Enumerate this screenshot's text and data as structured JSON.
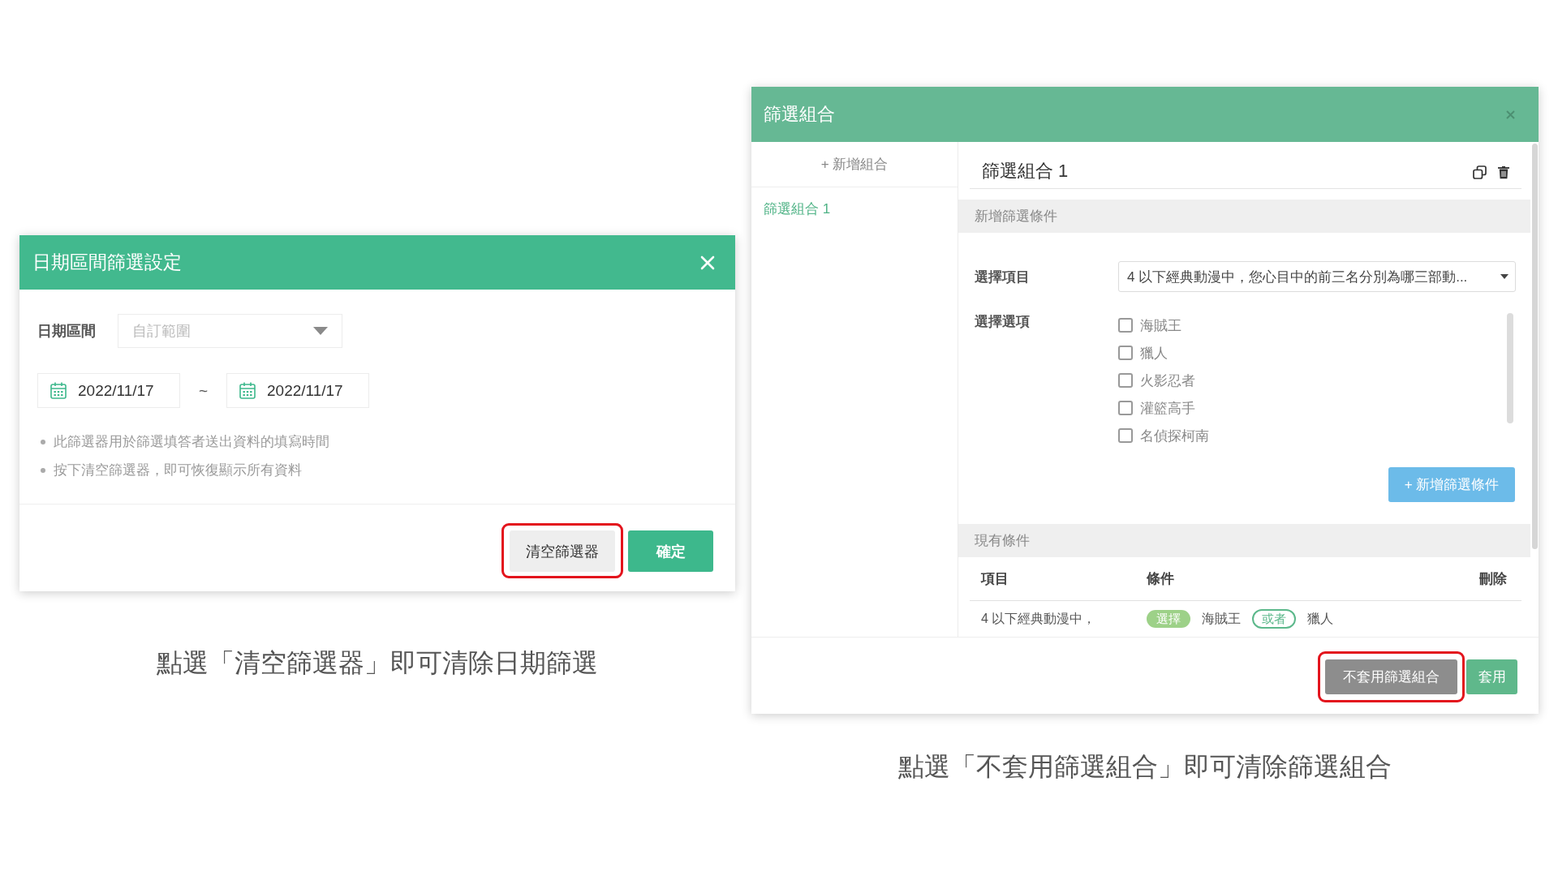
{
  "left_dialog": {
    "title": "日期區間篩選設定",
    "range_label": "日期區間",
    "range_select": {
      "value": "自訂範圍",
      "disabled": true
    },
    "start_date": {
      "value": "2022/11/17"
    },
    "separator": "~",
    "end_date": {
      "value": "2022/11/17"
    },
    "notes": [
      "此篩選器用於篩選填答者送出資料的填寫時間",
      "按下清空篩選器，即可恢復顯示所有資料"
    ],
    "buttons": [
      {
        "label": "清空篩選器",
        "kind": "secondary",
        "highlighted": true
      },
      {
        "label": "確定",
        "kind": "primary",
        "highlighted": false
      }
    ]
  },
  "left_caption": "點選「清空篩選器」即可清除日期篩選",
  "right_dialog": {
    "title": "篩選組合",
    "sidebar": {
      "add_button": "+ 新增組合",
      "items": [
        {
          "label": "篩選組合 1",
          "selected": true
        }
      ]
    },
    "combo_name": "篩選組合 1",
    "add_section": {
      "heading": "新增篩選條件",
      "item_label": "選擇項目",
      "item_select": {
        "value": "4 以下經典動漫中，您心目中的前三名分別為哪三部動..."
      },
      "option_label": "選擇選項",
      "options": [
        {
          "label": "海賊王",
          "checked": false
        },
        {
          "label": "獵人",
          "checked": false
        },
        {
          "label": "火影忍者",
          "checked": false
        },
        {
          "label": "灌籃高手",
          "checked": false
        },
        {
          "label": "名偵探柯南",
          "checked": false
        }
      ],
      "add_button": "+ 新增篩選條件"
    },
    "current_section": {
      "heading": "現有條件",
      "columns": [
        "項目",
        "條件",
        "刪除"
      ],
      "rows": [
        {
          "item": "4 以下經典動漫中，",
          "conditions": [
            {
              "kind": "filled",
              "text": "選擇"
            },
            {
              "kind": "plain",
              "text": "海賊王"
            },
            {
              "kind": "outline",
              "text": "或者"
            },
            {
              "kind": "plain",
              "text": "獵人"
            }
          ]
        }
      ]
    },
    "buttons": [
      {
        "label": "不套用篩選組合",
        "kind": "neutral",
        "highlighted": true
      },
      {
        "label": "套用",
        "kind": "primary",
        "highlighted": false
      }
    ]
  },
  "right_caption": "點選「不套用篩選組合」即可清除篩選組合"
}
